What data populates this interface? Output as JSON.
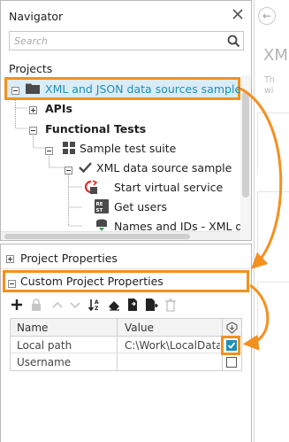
{
  "navigator": {
    "title": "Navigator",
    "search_placeholder": "Search",
    "projects_label": "Projects",
    "tree": [
      {
        "label": "XML and JSON data sources sample",
        "icon": "folder-icon",
        "selected": true
      },
      {
        "label": "APIs",
        "icon": "plus-expander-icon"
      },
      {
        "label": "Functional Tests",
        "icon": "minus-expander-icon"
      },
      {
        "label": "Sample test suite",
        "icon": "test-suite-grid-icon"
      },
      {
        "label": "XML data source sample",
        "icon": "checkmark-icon"
      },
      {
        "label": "Start virtual service",
        "icon": "virtual-service-icon"
      },
      {
        "label": "Get users",
        "icon": "rest-request-icon"
      },
      {
        "label": "Names and IDs - XML da",
        "icon": "data-source-icon"
      }
    ]
  },
  "properties": {
    "project_properties_label": "Project Properties",
    "custom_project_properties_label": "Custom Project Properties",
    "toolbar": [
      "add-icon",
      "lock-icon",
      "move-up-icon",
      "move-down-icon",
      "sort-icon",
      "clear-icon",
      "load-icon",
      "save-icon",
      "delete-icon"
    ],
    "columns": {
      "name": "Name",
      "value": "Value",
      "sync_icon": "sync-icon"
    },
    "rows": [
      {
        "name": "Local path",
        "value": "C:\\Work\\LocalData",
        "checked": true
      },
      {
        "name": "Username",
        "value": "",
        "checked": false
      }
    ]
  },
  "right_panel": {
    "big_text": "XM",
    "line1": "Th",
    "line2": "wi"
  },
  "colors": {
    "accent_highlight": "#f4901e",
    "selected_row_bg": "#d9ecf7",
    "selected_text": "#1e8fb5",
    "checkbox_checked": "#1e8fb5"
  }
}
